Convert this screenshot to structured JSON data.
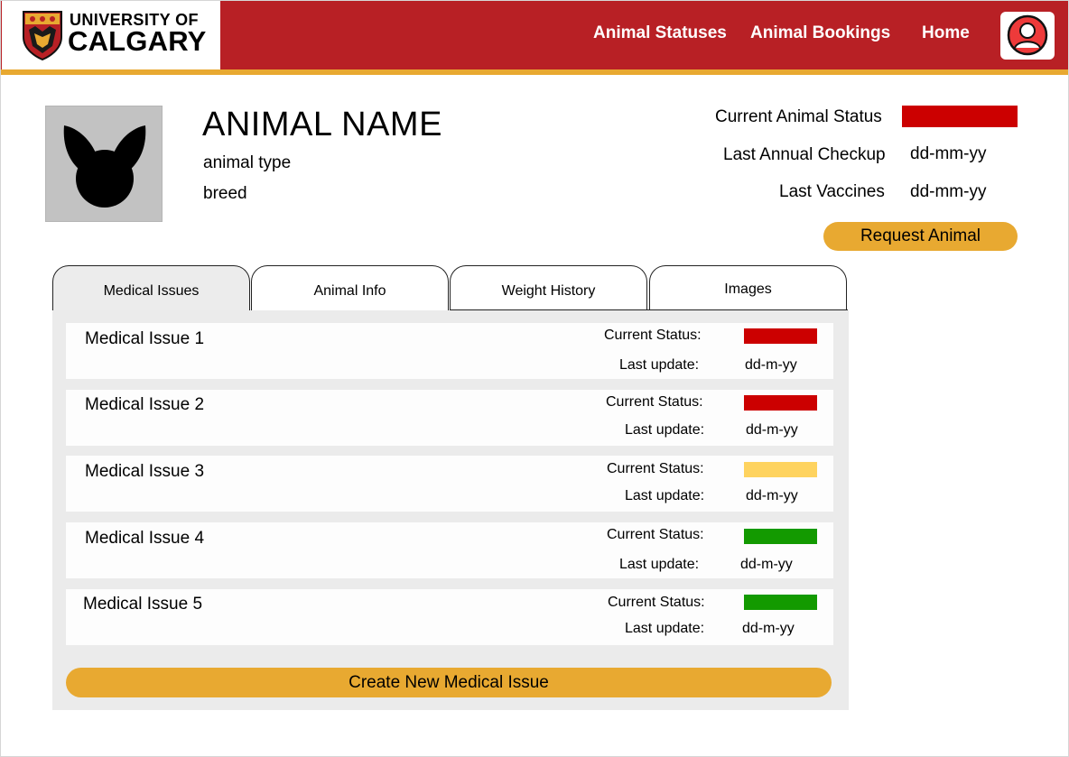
{
  "header": {
    "logo_line1": "UNIVERSITY OF",
    "logo_line2": "CALGARY",
    "nav": [
      "Animal Statuses",
      "Animal Bookings",
      "Home"
    ],
    "brand_color": "#b82025",
    "accent_color": "#e8a931",
    "profile_icon": "user-avatar-icon"
  },
  "profile": {
    "photo_icon": "animal-silhouette-icon",
    "name": "ANIMAL NAME",
    "type": "animal type",
    "breed": "breed",
    "status_label": "Current Animal Status",
    "status_color": "#cc0000",
    "checkup_label": "Last Annual Checkup",
    "checkup_value": "dd-mm-yy",
    "vaccines_label": "Last Vaccines",
    "vaccines_value": "dd-mm-yy",
    "request_button": "Request Animal"
  },
  "tabs": [
    {
      "label": "Medical Issues",
      "active": true
    },
    {
      "label": "Animal Info",
      "active": false
    },
    {
      "label": "Weight History",
      "active": false
    },
    {
      "label": "Images",
      "active": false
    }
  ],
  "medical_issues": [
    {
      "title": "Medical Issue 1",
      "status_label": "Current Status:",
      "status_color": "#cc0000",
      "update_label": "Last update:",
      "update_value": "dd-m-yy"
    },
    {
      "title": "Medical Issue 2",
      "status_label": "Current Status:",
      "status_color": "#cc0000",
      "update_label": "Last update:",
      "update_value": "dd-m-yy"
    },
    {
      "title": "Medical Issue 3",
      "status_label": "Current Status:",
      "status_color": "#fed35f",
      "update_label": "Last update:",
      "update_value": "dd-m-yy"
    },
    {
      "title": "Medical Issue 4",
      "status_label": "Current Status:",
      "status_color": "#139a00",
      "update_label": "Last update:",
      "update_value": "dd-m-yy"
    },
    {
      "title": "Medical Issue 5",
      "status_label": "Current Status:",
      "status_color": "#139a00",
      "update_label": "Last update:",
      "update_value": "dd-m-yy"
    }
  ],
  "create_button": "Create New Medical Issue"
}
